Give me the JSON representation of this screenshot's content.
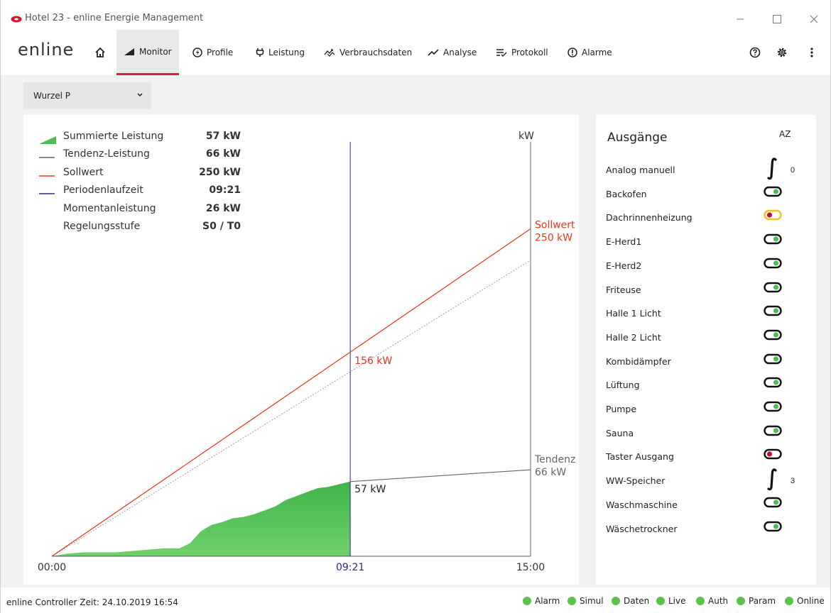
{
  "window": {
    "title": "Hotel 23 - enline Energie Management"
  },
  "nav": {
    "logo": "enline",
    "items": [
      {
        "label": "Monitor",
        "icon": "signal-icon",
        "active": true
      },
      {
        "label": "Profile",
        "icon": "power-icon"
      },
      {
        "label": "Leistung",
        "icon": "plug-icon"
      },
      {
        "label": "Verbrauchsdaten",
        "icon": "trend-updown-icon"
      },
      {
        "label": "Analyse",
        "icon": "line-chart-icon"
      },
      {
        "label": "Protokoll",
        "icon": "list-check-icon"
      },
      {
        "label": "Alarme",
        "icon": "alert-circle-icon"
      }
    ]
  },
  "selector": {
    "value": "Wurzel P"
  },
  "legend": [
    {
      "label": "Summierte Leistung",
      "value": "57 kW"
    },
    {
      "label": "Tendenz-Leistung",
      "value": "66 kW"
    },
    {
      "label": "Sollwert",
      "value": "250 kW"
    },
    {
      "label": "Periodenlaufzeit",
      "value": "09:21"
    },
    {
      "label": "Momentanleistung",
      "value": "26 kW"
    },
    {
      "label": "Regelungsstufe",
      "value": "S0 / T0"
    }
  ],
  "chart_data": {
    "type": "area",
    "ylabel": "kW",
    "x_ticks": [
      "00:00",
      "09:21",
      "15:00"
    ],
    "x_minutes": {
      "start": 0,
      "current": 561,
      "end": 900
    },
    "ylim": [
      0,
      325
    ],
    "sollwert_end": 250,
    "sollwert_now": 156,
    "tendenz_end": 66,
    "summiert_now": 57,
    "dashed_end": 226,
    "series_summiert": [
      [
        0,
        0
      ],
      [
        30,
        2
      ],
      [
        60,
        3
      ],
      [
        90,
        3
      ],
      [
        120,
        3
      ],
      [
        150,
        4
      ],
      [
        180,
        5
      ],
      [
        210,
        6
      ],
      [
        240,
        6
      ],
      [
        260,
        10
      ],
      [
        280,
        19
      ],
      [
        300,
        24
      ],
      [
        320,
        26
      ],
      [
        340,
        29
      ],
      [
        360,
        30
      ],
      [
        380,
        32
      ],
      [
        400,
        35
      ],
      [
        420,
        38
      ],
      [
        440,
        43
      ],
      [
        460,
        46
      ],
      [
        480,
        49
      ],
      [
        500,
        52
      ],
      [
        520,
        53
      ],
      [
        540,
        55
      ],
      [
        561,
        57
      ]
    ],
    "annotations": {
      "sollwert_label": "Sollwert",
      "sollwert_value": "250 kW",
      "now_sollwert": "156 kW",
      "now_summiert": "57 kW",
      "tendenz_label": "Tendenz",
      "tendenz_value": "66 kW"
    },
    "colors": {
      "area": "#4cbd50",
      "sollwert": "#e8361a",
      "tendenz": "#666666",
      "period": "#2b2a8a"
    }
  },
  "outputs": {
    "title": "Ausgänge",
    "sort_label": "AZ",
    "items": [
      {
        "name": "Analog manuell",
        "type": "analog",
        "value": "0"
      },
      {
        "name": "Backofen",
        "type": "toggle",
        "state": "on"
      },
      {
        "name": "Dachrinnenheizung",
        "type": "toggle",
        "state": "warn"
      },
      {
        "name": "E-Herd1",
        "type": "toggle",
        "state": "on"
      },
      {
        "name": "E-Herd2",
        "type": "toggle",
        "state": "on"
      },
      {
        "name": "Friteuse",
        "type": "toggle",
        "state": "on"
      },
      {
        "name": "Halle 1 Licht",
        "type": "toggle",
        "state": "on"
      },
      {
        "name": "Halle 2 Licht",
        "type": "toggle",
        "state": "on"
      },
      {
        "name": "Kombidämpfer",
        "type": "toggle",
        "state": "on"
      },
      {
        "name": "Lüftung",
        "type": "toggle",
        "state": "on"
      },
      {
        "name": "Pumpe",
        "type": "toggle",
        "state": "on"
      },
      {
        "name": "Sauna",
        "type": "toggle",
        "state": "on"
      },
      {
        "name": "Taster Ausgang",
        "type": "toggle",
        "state": "off"
      },
      {
        "name": "WW-Speicher",
        "type": "analog",
        "value": "3"
      },
      {
        "name": "Waschmaschine",
        "type": "toggle",
        "state": "on"
      },
      {
        "name": "Wäschetrockner",
        "type": "toggle",
        "state": "on"
      }
    ]
  },
  "status": {
    "time_text": "enline Controller Zeit: 24.10.2019 16:54",
    "indicators": [
      "Alarm",
      "Simul",
      "Daten",
      "Live",
      "Auth",
      "Param",
      "Online"
    ]
  }
}
